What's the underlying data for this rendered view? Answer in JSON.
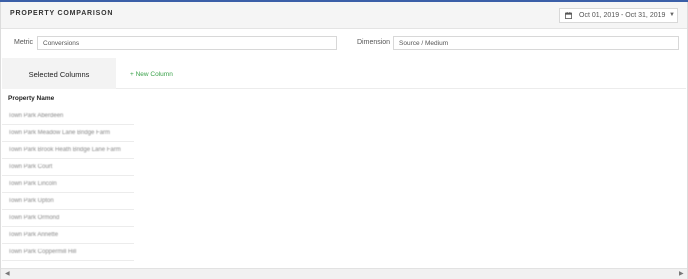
{
  "header": {
    "title": "PROPERTY COMPARISON",
    "date_range": "Oct 01, 2019 - Oct 31, 2019"
  },
  "filters": {
    "metric_label": "Metric",
    "metric_value": "Conversions",
    "dimension_label": "Dimension",
    "dimension_value": "Source / Medium"
  },
  "columns": {
    "selected_label": "Selected Columns",
    "new_column_label": "+ New Column"
  },
  "table": {
    "header": "Property Name",
    "rows": [
      "Town Park Aberdeen",
      "Town Park Meadow Lane Bridge Farm",
      "Town Park Brook Heath Bridge Lane Farm",
      "Town Park Court",
      "Town Park Lincoln",
      "Town Park Upton",
      "Town Park Ormond",
      "Town Park Annette",
      "Town Park Coppermill Hill"
    ]
  },
  "icons": {
    "calendar": "calendar-icon",
    "chevron": "chevron-down-icon"
  },
  "colors": {
    "accent_top": "#3b5fa8",
    "new_column": "#3aa24a"
  }
}
